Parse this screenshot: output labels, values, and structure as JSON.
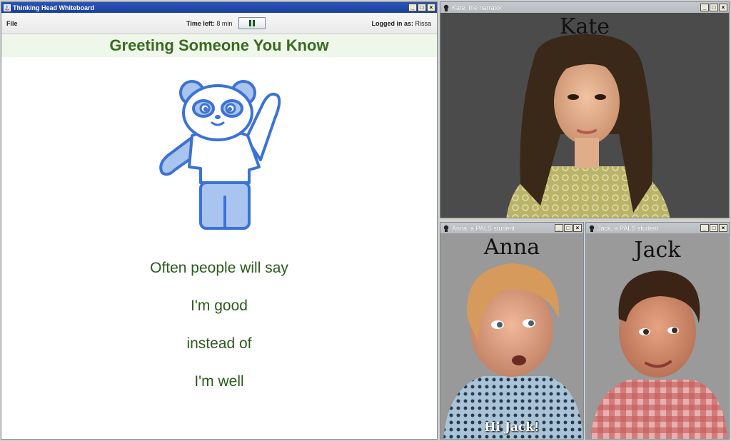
{
  "whiteboard": {
    "title": "Thinking Head Whiteboard",
    "menu_file": "File",
    "time_label": "Time left:",
    "time_value": "8 min",
    "logged_label": "Logged in as:",
    "logged_value": "Rissa",
    "lesson_title": "Greeting Someone You Know",
    "lines": [
      "Often people will say",
      "I'm good",
      "instead of",
      "I'm well"
    ]
  },
  "kate": {
    "title": "Kate, the narrator",
    "name": "Kate"
  },
  "anna": {
    "title": "Anna, a PALS student",
    "name": "Anna",
    "caption": "Hi Jack!"
  },
  "jack": {
    "title": "Jack, a PALS student",
    "name": "Jack"
  },
  "window_buttons": {
    "minimize": "_",
    "maximize": "□",
    "close": "×"
  },
  "colors": {
    "title_active": "#1a3f9a",
    "heading": "#3a6b20",
    "body_text": "#2c5a1e",
    "panda": "#3b72d6"
  }
}
